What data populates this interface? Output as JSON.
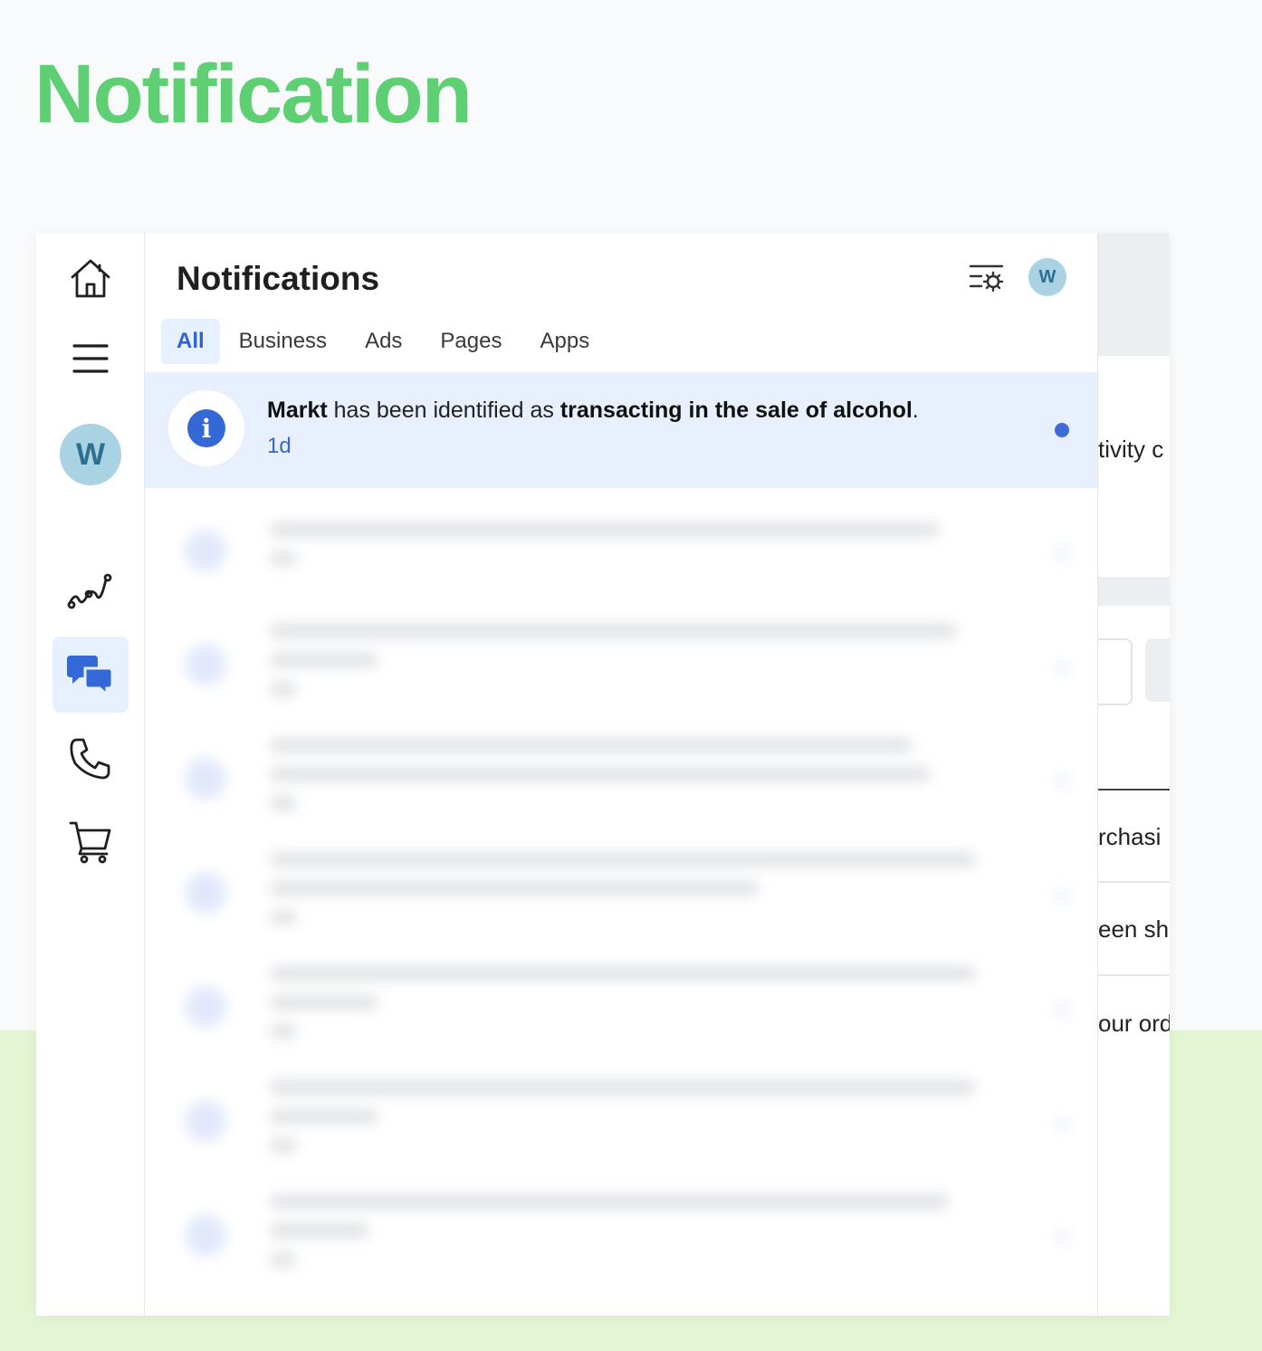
{
  "hero": {
    "title": "Notification"
  },
  "sidebar": {
    "avatar_initial": "W",
    "icons": [
      "home-icon",
      "menu-icon",
      "insights-icon",
      "messages-icon",
      "phone-icon",
      "cart-icon"
    ],
    "active_item": "messages-icon"
  },
  "panel": {
    "title": "Notifications",
    "avatar_initial": "W",
    "tabs": [
      {
        "label": "All",
        "active": true
      },
      {
        "label": "Business",
        "active": false
      },
      {
        "label": "Ads",
        "active": false
      },
      {
        "label": "Pages",
        "active": false
      },
      {
        "label": "Apps",
        "active": false
      }
    ],
    "notification": {
      "subject": "Markt",
      "middle": " has been identified as ",
      "emphasis": "transacting in the sale of alcohol",
      "end": ".",
      "time": "1d",
      "unread": true
    }
  },
  "background_window": {
    "fragments": [
      "tivity c",
      "rchasi",
      "een sh",
      "our ord"
    ]
  },
  "colors": {
    "hero_green": "#5fcf74",
    "accent_blue": "#3468d6",
    "highlight": "#e8f0fd",
    "bottom_band": "#e3f5d2"
  }
}
